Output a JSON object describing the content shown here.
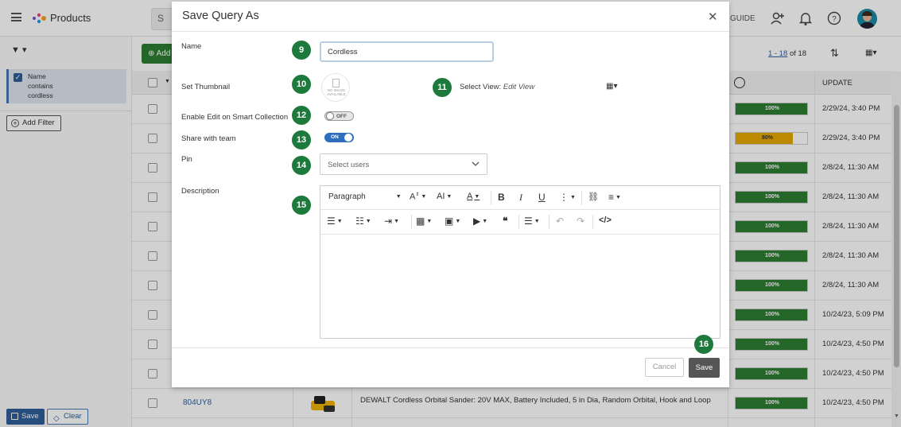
{
  "app": {
    "title": "Products",
    "search_glyph": "S",
    "guide_label": "GUIDE"
  },
  "sidebar": {
    "filter_chip": {
      "field": "Name",
      "operator": "contains",
      "value": "cordless"
    },
    "add_filter_label": "Add Filter",
    "save_label": "Save",
    "clear_label": "Clear"
  },
  "main": {
    "add_label": "Add",
    "pager": {
      "range": "1 - 18",
      "of_label": "of 18"
    },
    "update_header": "UPDATE",
    "rows": [
      {
        "pct": "100%",
        "progress": 1.0,
        "update": "2/29/24, 3:40 PM"
      },
      {
        "pct": "80%",
        "progress": 0.8,
        "update": "2/29/24, 3:40 PM"
      },
      {
        "pct": "100%",
        "progress": 1.0,
        "update": "2/8/24, 11:30 AM"
      },
      {
        "pct": "100%",
        "progress": 1.0,
        "update": "2/8/24, 11:30 AM"
      },
      {
        "pct": "100%",
        "progress": 1.0,
        "update": "2/8/24, 11:30 AM"
      },
      {
        "pct": "100%",
        "progress": 1.0,
        "update": "2/8/24, 11:30 AM"
      },
      {
        "pct": "100%",
        "progress": 1.0,
        "update": "2/8/24, 11:30 AM"
      },
      {
        "pct": "100%",
        "progress": 1.0,
        "update": "10/24/23, 5:09 PM"
      },
      {
        "pct": "100%",
        "progress": 1.0,
        "update": "10/24/23, 4:50 PM"
      },
      {
        "pct": "100%",
        "progress": 1.0,
        "update": "10/24/23, 4:50 PM"
      },
      {
        "pct": "100%",
        "progress": 1.0,
        "update": "10/24/23, 4:50 PM",
        "code": "804UY8",
        "product": "DEWALT Cordless Orbital Sander: 20V MAX, Battery Included, 5 in Dia, Random Orbital, Hook and Loop"
      }
    ]
  },
  "modal": {
    "title": "Save Query As",
    "close_glyph": "✕",
    "name_label": "Name",
    "name_value": "Cordless",
    "thumbnail_label": "Set Thumbnail",
    "no_image_text": "NO IMAGE AVAILABLE",
    "select_view_label": "Select View:",
    "select_view_link": "Edit View",
    "smart_collection_label": "Enable Edit on Smart Collection",
    "smart_collection_state": "OFF",
    "share_label": "Share with team",
    "share_state": "ON",
    "pin_label": "Pin",
    "pin_placeholder": "Select users",
    "description_label": "Description",
    "paragraph_label": "Paragraph",
    "cancel_label": "Cancel",
    "save_label": "Save",
    "badges": {
      "name": "9",
      "thumbnail": "10",
      "view": "11",
      "smart": "12",
      "share": "13",
      "pin": "14",
      "description": "15",
      "save": "16"
    }
  },
  "colors": {
    "accent_blue": "#2f5e99",
    "badge_green": "#1e7a3c",
    "progress_green": "#2e7d32",
    "progress_yellow": "#e6a800",
    "toggle_on": "#2f6dbd"
  },
  "icons": [
    "hamburger-icon",
    "logo-icon",
    "search-icon",
    "add-user-icon",
    "bell-icon",
    "help-icon",
    "filter-icon",
    "sort-icon",
    "grid-view-icon",
    "close-icon",
    "bold-icon",
    "italic-icon",
    "underline-icon",
    "link-icon",
    "align-icon",
    "bullet-list-icon",
    "numbered-list-icon",
    "indent-icon",
    "table-icon",
    "image-icon",
    "video-icon",
    "quote-icon",
    "undo-icon",
    "redo-icon",
    "code-icon"
  ]
}
